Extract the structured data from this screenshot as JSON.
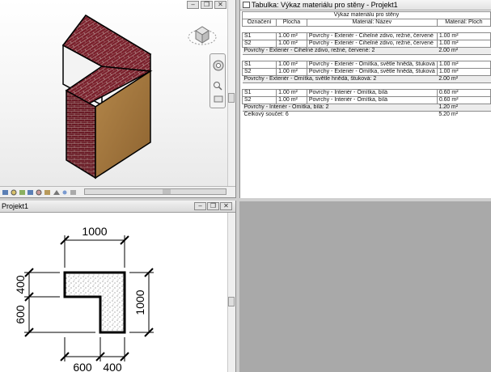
{
  "view3d": {
    "buttons": [
      "‒",
      "❐",
      "✕"
    ]
  },
  "plan_view": {
    "title": "Projekt1",
    "dims": {
      "top": "1000",
      "left_upper": "400",
      "left_lower": "600",
      "right": "1000",
      "bottom_left": "600",
      "bottom_right": "400"
    }
  },
  "schedule": {
    "title": "Tabulka: Výkaz materiálu pro stěny - Projekt1",
    "table_title": "Výkaz materiálu pro stěny",
    "columns": [
      "Označení",
      "Plocha",
      "Materiál: Název",
      "Materiál: Ploch"
    ],
    "groups": [
      {
        "rows": [
          [
            "S1",
            "1.00 m²",
            "Povrchy - Exteriér - Cihelné zdivo, režné, červené",
            "1.00 m²"
          ],
          [
            "S2",
            "1.00 m²",
            "Povrchy - Exteriér - Cihelné zdivo, režné, červené",
            "1.00 m²"
          ]
        ],
        "summary": "Povrchy - Exteriér - Cihelné zdivo, režné, červené: 2",
        "summary_value": "2.00 m²"
      },
      {
        "rows": [
          [
            "S1",
            "1.00 m²",
            "Povrchy - Exteriér - Omítka, světle hnědá, štuková",
            "1.00 m²"
          ],
          [
            "S2",
            "1.00 m²",
            "Povrchy - Exteriér - Omítka, světle hnědá, štuková",
            "1.00 m²"
          ]
        ],
        "summary": "Povrchy - Exteriér - Omítka, světle hnědá, štuková: 2",
        "summary_value": "2.00 m²"
      },
      {
        "rows": [
          [
            "S1",
            "1.00 m²",
            "Povrchy - Interiér - Omítka, bílá",
            "0.60 m²"
          ],
          [
            "S2",
            "1.00 m²",
            "Povrchy - Interiér - Omítka, bílá",
            "0.60 m²"
          ]
        ],
        "summary": "Povrchy - Interiér - Omítka, bílá: 2",
        "summary_value": "1.20 m²"
      }
    ],
    "total": "Celkový součet: 6",
    "total_value": "5.20 m²"
  },
  "colors": {
    "brick": "#7a1f2b",
    "brick_dark": "#5a1620",
    "stucco": "#a87a3f",
    "stucco_dark": "#6e4d22",
    "accent_blue": "#2a5a9a"
  }
}
